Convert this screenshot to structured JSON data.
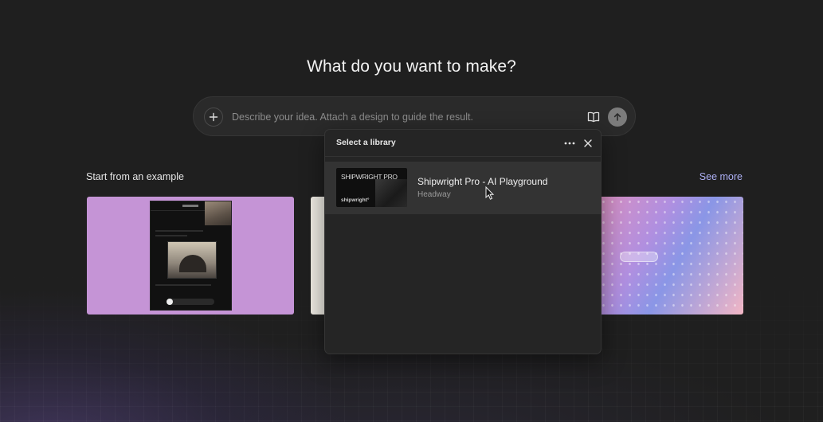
{
  "headline": "What do you want to make?",
  "prompt": {
    "placeholder": "Describe your idea. Attach a design to guide the result.",
    "value": "",
    "icons": {
      "add": "plus-icon",
      "library": "book-icon",
      "send": "arrow-up-icon"
    }
  },
  "examples": {
    "title": "Start from an example",
    "see_more_label": "See more"
  },
  "library_popup": {
    "title": "Select a library",
    "icons": {
      "more": "more-horizontal-icon",
      "close": "close-icon"
    },
    "items": [
      {
        "name": "Shipwright Pro - AI Playground",
        "owner": "Headway",
        "thumbnail_title": "SHIPWRIGHT PRO",
        "thumbnail_sub": "shipwright°"
      }
    ]
  },
  "colors": {
    "background": "#1f1f1f",
    "accent_link": "#aeb0f5",
    "popup_bg": "#252525",
    "selected_row": "#333333",
    "card_purple": "#c594d6"
  }
}
